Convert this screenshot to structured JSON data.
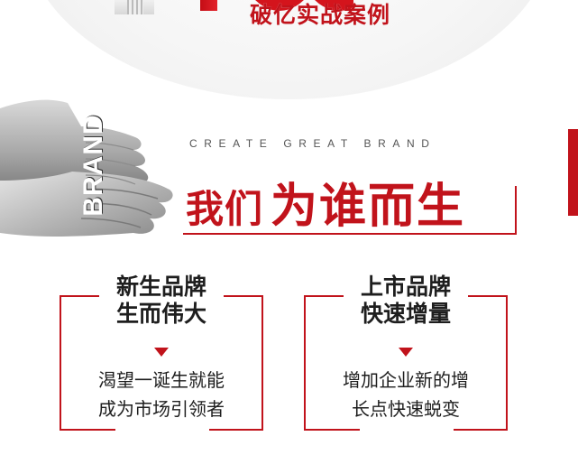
{
  "hero": {
    "headline": "破亿实战案例",
    "accent_color": "#c1131b"
  },
  "brand_block": {
    "vertical_word": "BRAND",
    "image_description_icon": "open-hands-icon"
  },
  "tagline": {
    "english": "CREATE GREAT BRAND",
    "title_part_a": "我们",
    "title_part_b": "为谁而生"
  },
  "cards": [
    {
      "head_line_1": "新生品牌",
      "head_line_2": "生而伟大",
      "body_line_1": "渴望一诞生就能",
      "body_line_2": "成为市场引领者"
    },
    {
      "head_line_1": "上市品牌",
      "head_line_2": "快速增量",
      "body_line_1": "增加企业新的增",
      "body_line_2": "长点快速蜕变"
    }
  ]
}
